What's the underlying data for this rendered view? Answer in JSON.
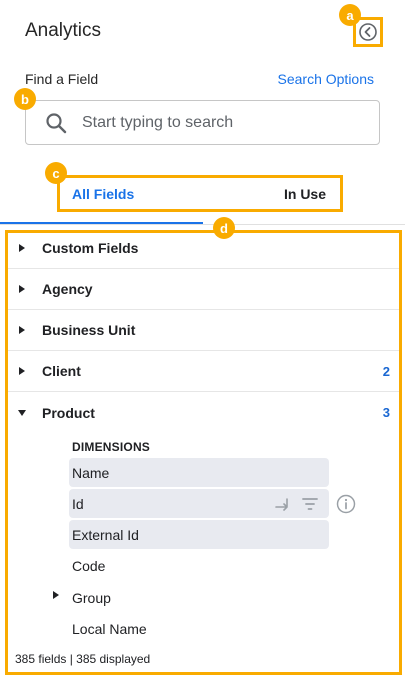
{
  "header": {
    "title": "Analytics"
  },
  "find": {
    "label": "Find a Field",
    "search_options": "Search Options",
    "placeholder": "Start typing to search"
  },
  "tabs": [
    {
      "label": "All Fields",
      "active": true
    },
    {
      "label": "In Use",
      "active": false
    }
  ],
  "badges": {
    "a": "a",
    "b": "b",
    "c": "c",
    "d": "d"
  },
  "groups": [
    {
      "label": "Custom Fields",
      "count": "",
      "expanded": false
    },
    {
      "label": "Agency",
      "count": "",
      "expanded": false
    },
    {
      "label": "Business Unit",
      "count": "",
      "expanded": false
    },
    {
      "label": "Client",
      "count": "2",
      "expanded": false
    },
    {
      "label": "Product",
      "count": "3",
      "expanded": true
    }
  ],
  "product": {
    "section": "DIMENSIONS",
    "fields": [
      {
        "label": "Name",
        "highlighted": true
      },
      {
        "label": "Id",
        "highlighted": true
      },
      {
        "label": "External Id",
        "highlighted": true
      },
      {
        "label": "Code",
        "highlighted": false
      },
      {
        "label": "Group",
        "highlighted": false,
        "expandable": true
      },
      {
        "label": "Local Name",
        "highlighted": false
      }
    ]
  },
  "footer": {
    "status": "385 fields | 385 displayed"
  },
  "colors": {
    "accent": "#1a73e8",
    "highlight": "#f9ab00",
    "count": "#1967d2"
  },
  "icons": [
    "chevron-left-circle-icon",
    "search-icon",
    "caret-right-icon",
    "caret-down-icon",
    "swap-icon",
    "filter-icon",
    "info-icon"
  ]
}
